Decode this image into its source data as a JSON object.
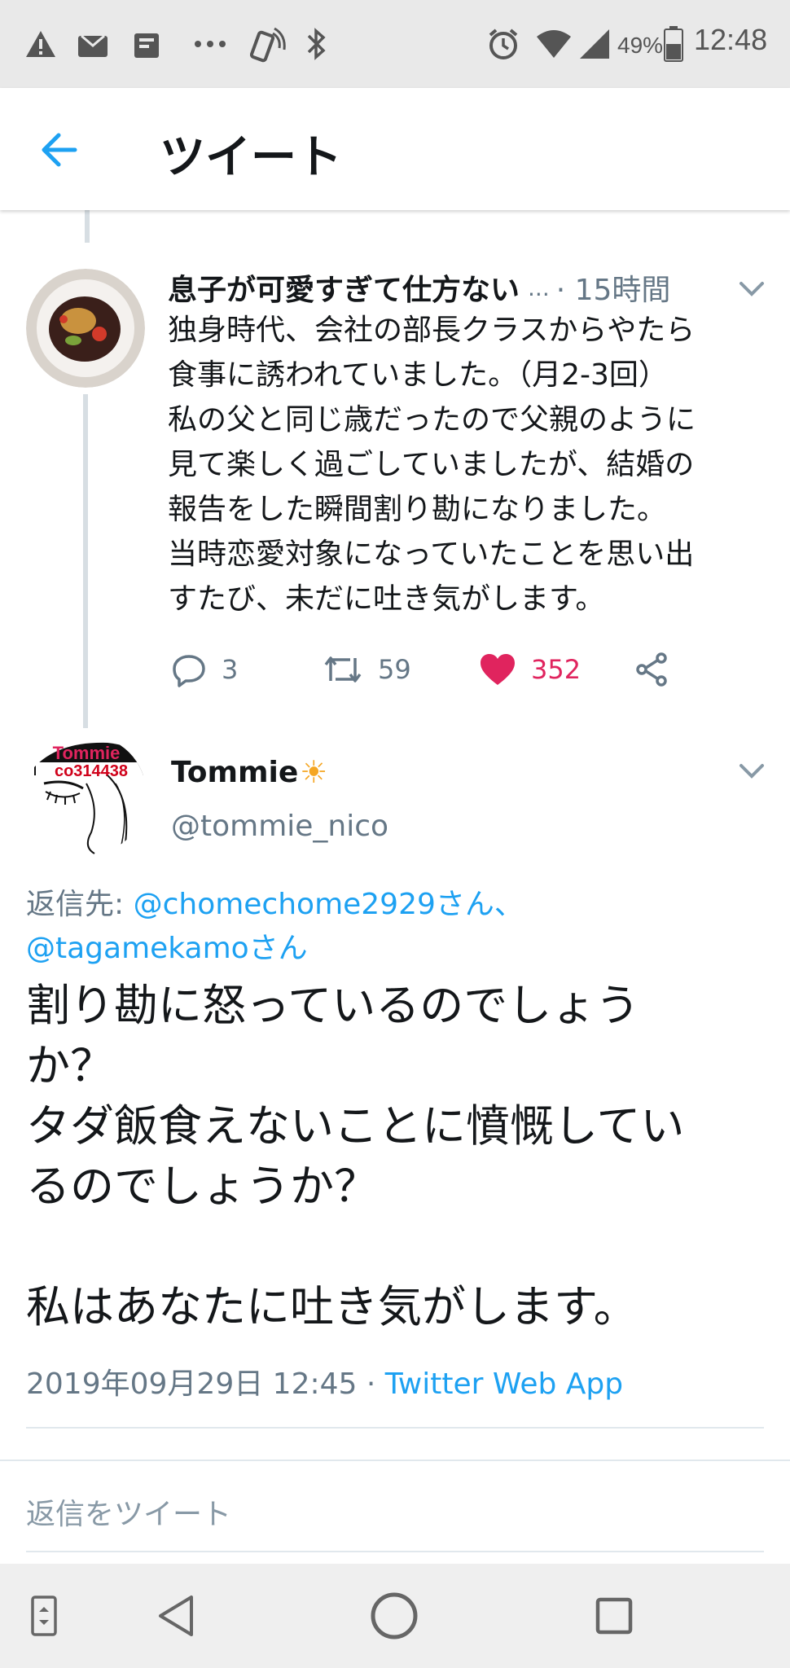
{
  "status_bar": {
    "battery": "49%",
    "time": "12:48",
    "icons": [
      "warning-icon",
      "mail-icon",
      "clipboard-icon",
      "more-icon",
      "nfc-icon",
      "bluetooth-icon",
      "alarm-icon",
      "wifi-icon",
      "signal-icon",
      "battery-icon"
    ]
  },
  "app_bar": {
    "title": "ツイート",
    "back_icon": "arrow-left-icon"
  },
  "parent_tweet": {
    "name": "息子が可愛すぎて仕方ない",
    "ellipsis": "...",
    "time": "· 15時間",
    "body": "独身時代、会社の部長クラスからやたら\n食事に誘われていました。（月2-3回）\n私の父と同じ歳だったので父親のように\n見て楽しく過ごしていましたが、結婚の\n報告をした瞬間割り勘になりました。\n当時恋愛対象になっていたことを思い出\nすたび、未だに吐き気がします。",
    "replies": "3",
    "retweets": "59",
    "likes": "352",
    "like_color": "#e0245e"
  },
  "main_tweet": {
    "name": "Tommie",
    "name_emoji": "☀",
    "handle": "@tommie_nico",
    "avatar_text_top": "Tommie",
    "avatar_text_code": "co314438",
    "reply_prefix": "返信先: ",
    "reply_to_1": "@chomechome2929さん、",
    "reply_to_2": "@tagamekamoさん",
    "body": "割り勘に怒っているのでしょう\nか？\nタダ飯食えないことに憤慨してい\nるのでしょうか？\n\n私はあなたに吐き気がします。",
    "timestamp": "2019年09月29日 12:45 · ",
    "source": "Twitter Web App"
  },
  "reply_box": {
    "placeholder": "返信をツイート"
  },
  "colors": {
    "accent": "#1da1f2",
    "muted": "#657786",
    "like": "#e0245e"
  },
  "nav_bar": {
    "icons": [
      "rotate-icon",
      "back-triangle-icon",
      "home-circle-icon",
      "recents-square-icon"
    ]
  }
}
